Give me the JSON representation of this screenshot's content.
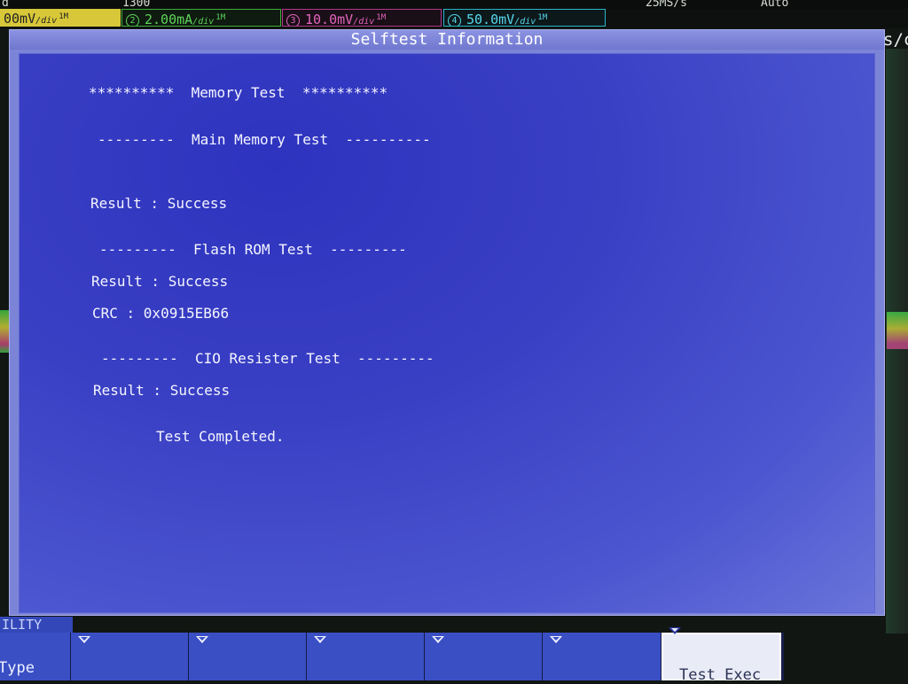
{
  "top_strip": {
    "left": "d",
    "mid": "1300",
    "rate": "25MS/s",
    "mode": "Auto"
  },
  "channels": [
    {
      "num": "",
      "value": "00mV",
      "unit": "/div",
      "cfg": "1M"
    },
    {
      "num": "2",
      "value": "2.00mA",
      "unit": "/div",
      "cfg": "1M"
    },
    {
      "num": "3",
      "value": "10.0mV",
      "unit": "/div",
      "cfg": "1M"
    },
    {
      "num": "4",
      "value": "50.0mV",
      "unit": "/div",
      "cfg": "1M"
    }
  ],
  "side_text": "s/c",
  "dialog": {
    "title": "Selftest Information",
    "lines": {
      "memory_header": "**********  Memory Test  **********",
      "main_memory_header": "---------  Main Memory Test  ----------",
      "main_memory_result": "Result : Success",
      "flash_header": "---------  Flash ROM Test  ---------",
      "flash_result": "Result : Success",
      "flash_crc": "CRC : 0x0915EB66",
      "cio_header": "---------  CIO Resister Test  ---------",
      "cio_result": "Result : Success",
      "completed": "Test Completed."
    }
  },
  "menu": {
    "tag": "ILITY",
    "softkeys": {
      "type": "Type",
      "exec": "Test Exec"
    }
  },
  "colors": {
    "ch1": "#d8c839",
    "ch2": "#5ed45a",
    "ch3": "#e364bd",
    "ch4": "#55d8eb",
    "dialog_bg": "#3a40c4"
  }
}
